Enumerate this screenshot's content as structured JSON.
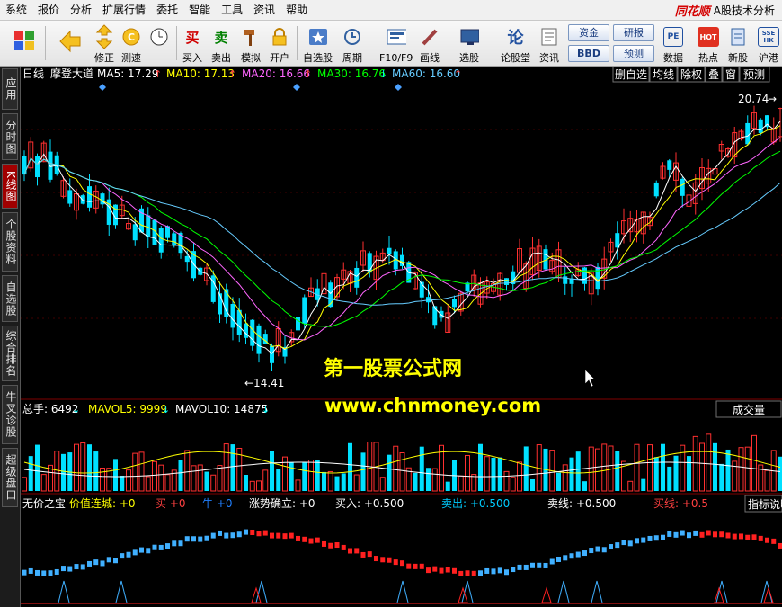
{
  "menu": {
    "items": [
      "系统",
      "报价",
      "分析",
      "扩展行情",
      "委托",
      "智能",
      "工具",
      "资讯",
      "帮助"
    ],
    "logo": "同花顺",
    "app_title": "A股技术分析"
  },
  "toolbar": {
    "buttons": [
      {
        "label": "",
        "icon": "grid-icon"
      },
      {
        "label": "",
        "icon": "back-arrow-icon"
      },
      {
        "label": "修正",
        "icon": "up-arrow-icon"
      },
      {
        "label": "测速",
        "icon": "speed-icon"
      },
      {
        "label": "买入",
        "icon": "buy-icon",
        "glyph": "买"
      },
      {
        "label": "卖出",
        "icon": "sell-icon",
        "glyph": "卖"
      },
      {
        "label": "模拟",
        "icon": "hammer-icon"
      },
      {
        "label": "开户",
        "icon": "lock-icon"
      },
      {
        "label": "自选股",
        "icon": "star-icon"
      },
      {
        "label": "周期",
        "icon": "period-icon"
      },
      {
        "label": "F10/F9",
        "icon": "f10-icon"
      },
      {
        "label": "画线",
        "icon": "pen-icon"
      },
      {
        "label": "选股",
        "icon": "monitor-icon"
      },
      {
        "label": "论股堂",
        "icon": "forum-icon"
      },
      {
        "label": "资讯",
        "icon": "news-icon"
      },
      {
        "label": "数据",
        "icon": "pe-icon",
        "glyph": "PE"
      },
      {
        "label": "热点",
        "icon": "hot-icon",
        "glyph": "HOT"
      },
      {
        "label": "新股",
        "icon": "ipo-icon"
      },
      {
        "label": "沪港",
        "icon": "hk-icon",
        "glyph": "SSE HK"
      }
    ],
    "small": {
      "fund": "资金",
      "bbd": "BBD",
      "research": "研报",
      "forecast": "预测"
    }
  },
  "left_tabs": [
    "应用",
    "分时图",
    "K线图",
    "个股资料",
    "自选股",
    "综合排名",
    "牛叉诊股",
    "超级盘口"
  ],
  "kline": {
    "period": "日线",
    "name": "摩登大道",
    "ma": [
      {
        "label": "MA5: 17.29",
        "color": "#ffffff"
      },
      {
        "label": "MA10: 17.13",
        "color": "#ffff00"
      },
      {
        "label": "MA20: 16.66",
        "color": "#ff66ff"
      },
      {
        "label": "MA30: 16.76",
        "color": "#00ff00"
      },
      {
        "label": "MA60: 16.60",
        "color": "#66ccff"
      }
    ],
    "right_buttons": [
      "删自选",
      "均线",
      "除权",
      "叠",
      "窗",
      "预测"
    ],
    "high_label": "20.74",
    "low_label": "←14.41",
    "watermark_title": "第一股票公式网",
    "watermark_url": "www.chnmoney.com"
  },
  "volume": {
    "total": "总手: 6492",
    "mavol5": "MAVOL5: 9999",
    "mavol10": "MAVOL10: 14875",
    "button": "成交量"
  },
  "indicator": {
    "labels": [
      {
        "text": "无价之宝",
        "color": "#ffffff"
      },
      {
        "text": "价值连城: +0",
        "color": "#ffff00"
      },
      {
        "text": "买 +0",
        "color": "#ff4040"
      },
      {
        "text": "牛 +0",
        "color": "#2080ff"
      },
      {
        "text": "涨势确立: +0",
        "color": "#ffffff"
      },
      {
        "text": "买入: +0.500",
        "color": "#ffffff"
      },
      {
        "text": "卖出: +0.500",
        "color": "#00ccff"
      },
      {
        "text": "卖线: +0.500",
        "color": "#ffffff"
      },
      {
        "text": "买线: +0.5",
        "color": "#ff4040"
      }
    ],
    "button": "指标说明"
  },
  "colors": {
    "up": "#ff3030",
    "down": "#00e0ff",
    "bg": "#000000",
    "grid": "#800000"
  }
}
